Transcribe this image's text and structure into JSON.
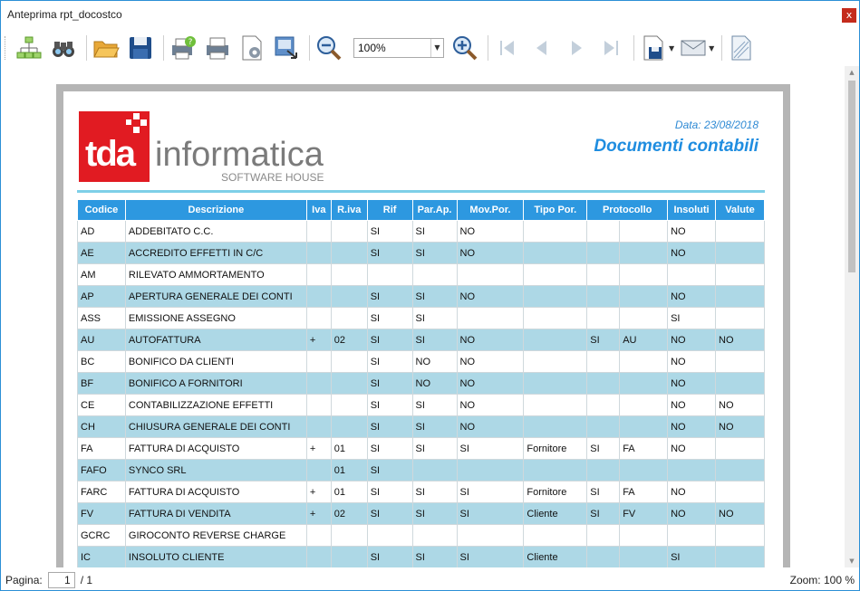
{
  "window": {
    "title": "Anteprima rpt_docostco",
    "close_glyph": "x"
  },
  "toolbar": {
    "buttons": [
      {
        "icon": "tree-icon"
      },
      {
        "icon": "binoculars-icon"
      },
      {
        "icon": "open-folder-icon"
      },
      {
        "icon": "save-icon"
      },
      {
        "icon": "print-setup-icon"
      },
      {
        "icon": "print-icon"
      },
      {
        "icon": "page-settings-icon"
      },
      {
        "icon": "export-icon"
      },
      {
        "icon": "zoom-out-icon"
      },
      {
        "icon": "zoom-in-icon"
      },
      {
        "icon": "first-page-icon"
      },
      {
        "icon": "prev-page-icon"
      },
      {
        "icon": "next-page-icon"
      },
      {
        "icon": "last-page-icon"
      },
      {
        "icon": "save-as-icon"
      },
      {
        "icon": "mail-icon"
      },
      {
        "icon": "watermark-icon"
      }
    ],
    "zoom_value": "100%"
  },
  "report": {
    "logo": {
      "brand": "tda",
      "name": "informatica",
      "tagline": "SOFTWARE HOUSE"
    },
    "date": "Data: 23/08/2018",
    "title": "Documenti contabili",
    "columns": [
      "Codice",
      "Descrizione",
      "Iva",
      "R.iva",
      "Rif",
      "Par.Ap.",
      "Mov.Por.",
      "Tipo Por.",
      "Protocollo",
      "Insoluti",
      "Valute"
    ],
    "rows": [
      [
        "AD",
        "ADDEBITATO C.C.",
        "",
        "",
        "SI",
        "SI",
        "NO",
        "",
        "",
        "",
        "NO",
        ""
      ],
      [
        "AE",
        "ACCREDITO EFFETTI IN C/C",
        "",
        "",
        "SI",
        "SI",
        "NO",
        "",
        "",
        "",
        "NO",
        ""
      ],
      [
        "AM",
        "RILEVATO AMMORTAMENTO",
        "",
        "",
        "",
        "",
        "",
        "",
        "",
        "",
        "",
        ""
      ],
      [
        "AP",
        "APERTURA GENERALE DEI CONTI",
        "",
        "",
        "SI",
        "SI",
        "NO",
        "",
        "",
        "",
        "NO",
        ""
      ],
      [
        "ASS",
        "EMISSIONE ASSEGNO",
        "",
        "",
        "SI",
        "SI",
        "",
        "",
        "",
        "",
        "SI",
        ""
      ],
      [
        "AU",
        "AUTOFATTURA",
        "+",
        "02",
        "SI",
        "SI",
        "NO",
        "",
        "SI",
        "AU",
        "NO",
        "NO"
      ],
      [
        "BC",
        "BONIFICO DA CLIENTI",
        "",
        "",
        "SI",
        "NO",
        "NO",
        "",
        "",
        "",
        "NO",
        ""
      ],
      [
        "BF",
        "BONIFICO A FORNITORI",
        "",
        "",
        "SI",
        "NO",
        "NO",
        "",
        "",
        "",
        "NO",
        ""
      ],
      [
        "CE",
        "CONTABILIZZAZIONE EFFETTI",
        "",
        "",
        "SI",
        "SI",
        "NO",
        "",
        "",
        "",
        "NO",
        "NO"
      ],
      [
        "CH",
        "CHIUSURA GENERALE DEI CONTI",
        "",
        "",
        "SI",
        "SI",
        "NO",
        "",
        "",
        "",
        "NO",
        "NO"
      ],
      [
        "FA",
        "FATTURA DI ACQUISTO",
        "+",
        "01",
        "SI",
        "SI",
        "SI",
        "Fornitore",
        "SI",
        "FA",
        "NO",
        ""
      ],
      [
        "FAFO",
        "SYNCO SRL",
        "",
        "01",
        "SI",
        "",
        "",
        "",
        "",
        "",
        "",
        ""
      ],
      [
        "FARC",
        "FATTURA DI ACQUISTO",
        "+",
        "01",
        "SI",
        "SI",
        "SI",
        "Fornitore",
        "SI",
        "FA",
        "NO",
        ""
      ],
      [
        "FV",
        "FATTURA DI VENDITA",
        "+",
        "02",
        "SI",
        "SI",
        "SI",
        "Cliente",
        "SI",
        "FV",
        "NO",
        "NO"
      ],
      [
        "GCRC",
        "GIROCONTO REVERSE CHARGE",
        "",
        "",
        "",
        "",
        "",
        "",
        "",
        "",
        "",
        ""
      ],
      [
        "IC",
        "INSOLUTO CLIENTE",
        "",
        "",
        "SI",
        "SI",
        "SI",
        "Cliente",
        "",
        "",
        "SI",
        ""
      ]
    ]
  },
  "status": {
    "page_label": "Pagina:",
    "page_value": "1",
    "page_total": "/ 1",
    "zoom_text": "Zoom: 100 %"
  },
  "colors": {
    "header_bg": "#2d98e0",
    "alt_row": "#add8e6",
    "title_blue": "#1f8de0",
    "logo_red": "#e11b22"
  }
}
